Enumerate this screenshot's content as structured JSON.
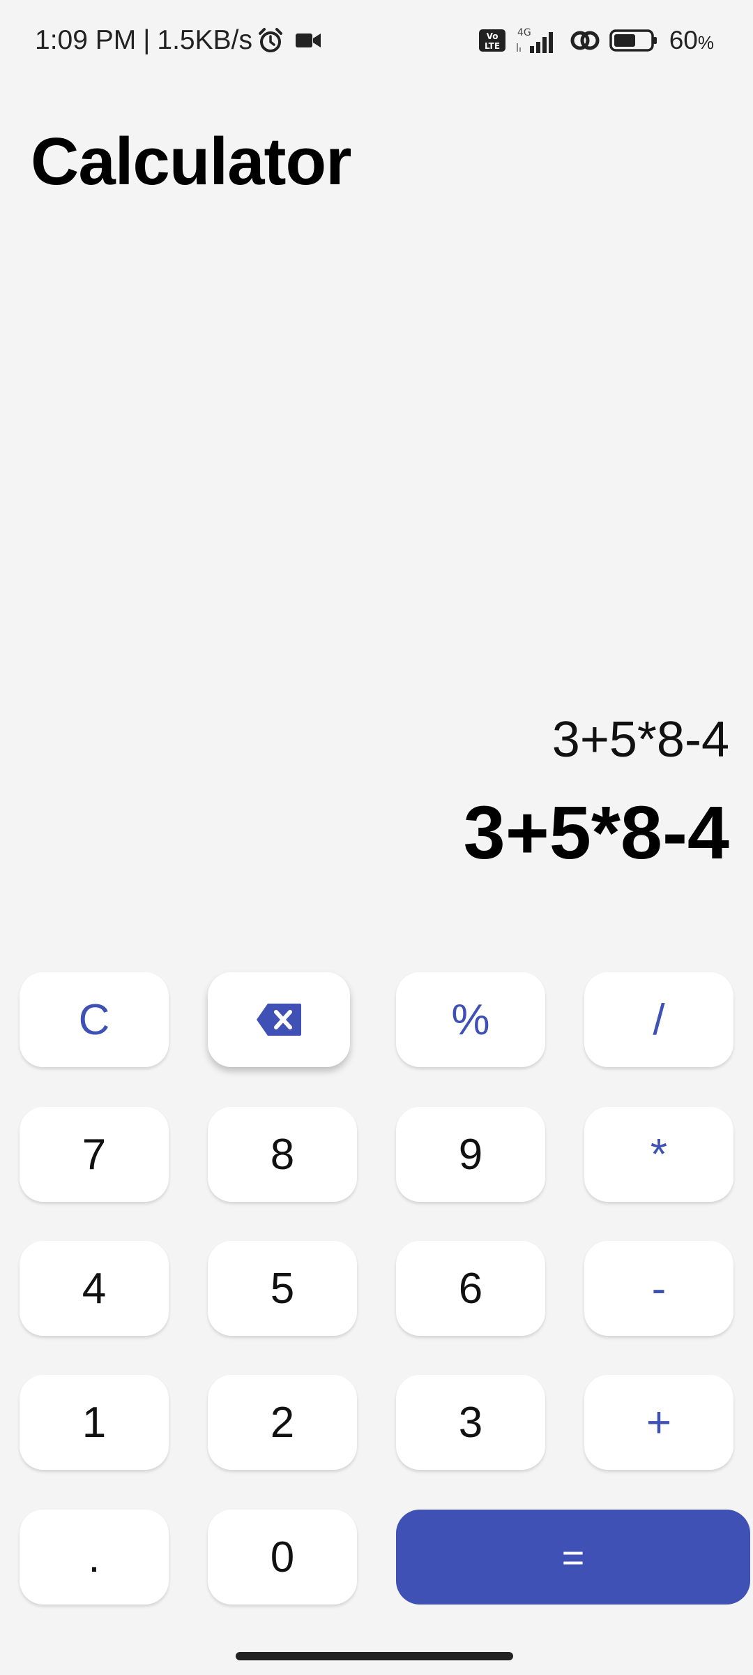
{
  "status_bar": {
    "time": "1:09 PM",
    "separator": "|",
    "speed": "1.5KB/s",
    "network_type": "4G",
    "volte": "Vo LTE",
    "battery_percent": "60",
    "battery_unit": "%",
    "battery_level": 0.6,
    "icons": [
      "alarm-icon",
      "video-camera-icon",
      "volte-icon",
      "signal-icon",
      "link-icon",
      "battery-icon"
    ]
  },
  "app": {
    "title": "Calculator"
  },
  "display": {
    "expression": "3+5*8-4",
    "result": "3+5*8-4"
  },
  "keypad": {
    "clear": "C",
    "backspace_icon": "backspace-icon",
    "percent": "%",
    "divide": "/",
    "seven": "7",
    "eight": "8",
    "nine": "9",
    "multiply": "*",
    "four": "4",
    "five": "5",
    "six": "6",
    "minus": "-",
    "one": "1",
    "two": "2",
    "three": "3",
    "plus": "+",
    "decimal": ".",
    "zero": "0",
    "equals": "="
  },
  "colors": {
    "background": "#f4f4f4",
    "key_background": "#ffffff",
    "accent": "#3f51b5",
    "text": "#111111"
  }
}
